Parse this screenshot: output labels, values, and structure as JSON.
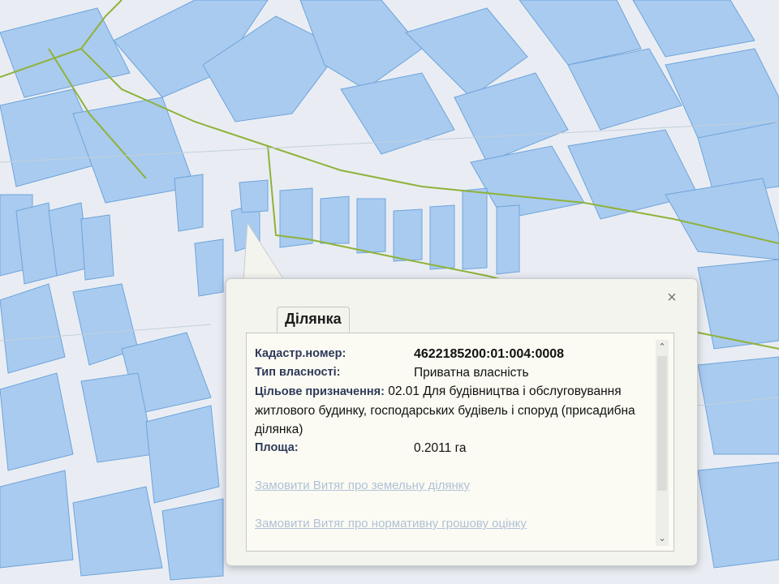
{
  "popup": {
    "tab_label": "Ділянка",
    "close_glyph": "×",
    "fields": {
      "cadastral_label": "Кадастр.номер:",
      "cadastral_value": "4622185200:01:004:0008",
      "ownership_label": "Тип власності:",
      "ownership_value": "Приватна власність",
      "purpose_label": "Цільове призначення:",
      "purpose_value": "02.01 Для будівництва і обслуговування житлового будинку, господарських будівель і споруд (присадибна ділянка)",
      "area_label": "Площа:",
      "area_value": "0.2011 га"
    },
    "links": [
      "Замовити Витяг про земельну ділянку",
      "Замовити Витяг про нормативну грошову оцінку"
    ],
    "scroll_up_glyph": "⌃",
    "scroll_down_glyph": "⌄"
  },
  "colors": {
    "parcel_fill": "#a9cbef",
    "parcel_stroke": "#6ea4dc",
    "boundary_line": "#8fb23a",
    "map_background": "#e8ecf2"
  }
}
